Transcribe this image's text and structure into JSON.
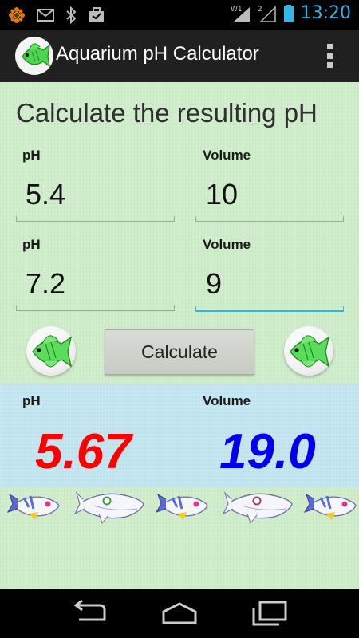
{
  "status_bar": {
    "time": "13:20",
    "icons": [
      "flower-icon",
      "gmail-icon",
      "bluetooth-icon",
      "briefcase-icon",
      "wifi-icon",
      "signal-icon",
      "battery-icon"
    ]
  },
  "action_bar": {
    "title": "Aquarium pH Calculator",
    "overflow_icon": "overflow-menu-icon"
  },
  "form": {
    "heading": "Calculate the resulting pH",
    "inputs": [
      {
        "ph_label": "pH",
        "ph_value": "5.4",
        "volume_label": "Volume",
        "volume_value": "10"
      },
      {
        "ph_label": "pH",
        "ph_value": "7.2",
        "volume_label": "Volume",
        "volume_value": "9"
      }
    ],
    "calculate_label": "Calculate"
  },
  "result": {
    "ph_label": "pH",
    "ph_value": "5.67",
    "volume_label": "Volume",
    "volume_value": "19.0",
    "ph_color": "#ff0000",
    "volume_color": "#0000ee"
  },
  "colors": {
    "accent": "#33b5e5",
    "content_bg": "#cfeccb",
    "result_bg": "#bfe3ee"
  },
  "nav_bar": {
    "icons": [
      "back-icon",
      "home-icon",
      "recent-apps-icon"
    ]
  }
}
